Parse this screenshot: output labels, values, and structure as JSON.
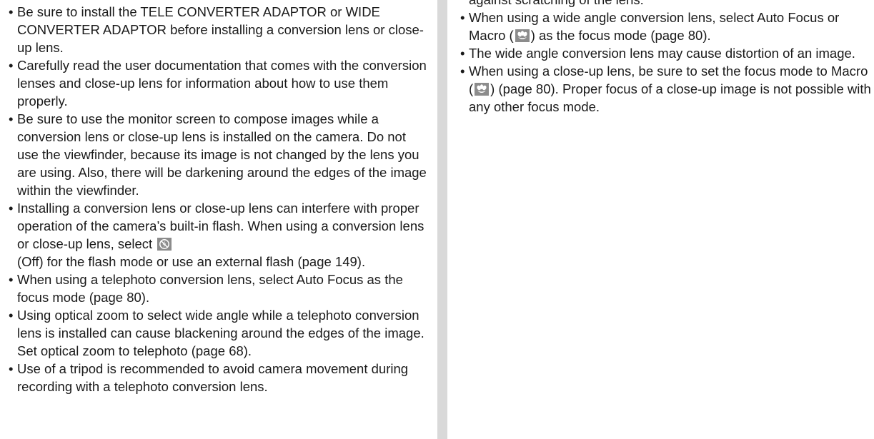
{
  "left_column": {
    "b1": "Be sure to install the TELE CONVERTER ADAPTOR or WIDE CONVERTER ADAPTOR before installing a conversion lens or close-up lens.",
    "b2": "Carefully read the user documentation that comes with the conversion lenses and close-up lens for information about how to use them properly.",
    "b3": "Be sure to use the monitor screen to compose images while a conversion lens or close-up lens is installed on the camera. Do not use the viewfinder, because its image is not changed by the lens you are using. Also, there will be darkening around the edges of the image within the viewfinder.",
    "b4_pre": "Installing a conversion lens or close-up lens can interfere with proper operation of the camera’s built-in flash. When using a conversion lens or close-up lens, select",
    "b4_post": "(Off) for the flash mode or use an external flash (page 149).",
    "b5": "When using a telephoto conversion lens, select Auto Focus as the focus mode (page 80).",
    "b6": "Using optical zoom to select wide angle while a telephoto conversion lens is installed can cause blackening around the edges of the image. Set optical zoom to telephoto (page 68).",
    "b7": "Use of a tripod is recommended to avoid camera movement during recording with a telephoto conversion lens."
  },
  "right_column": {
    "cont_line": "against scratching of the lens.",
    "b1_pre": "When using a wide angle conversion lens, select Auto Focus or Macro (",
    "b1_post": ") as the focus mode (page 80).",
    "b2": "The wide angle conversion lens may cause distortion of an image.",
    "b3_pre": "When using a close-up lens, be sure to set the focus mode to Macro (",
    "b3_post": ") (page 80).  Proper focus of a close-up image is not possible with any other focus mode."
  },
  "icons": {
    "flash_off": "flash-off-icon",
    "macro": "macro-flower-icon",
    "icon_color": "#8c8c8c"
  }
}
